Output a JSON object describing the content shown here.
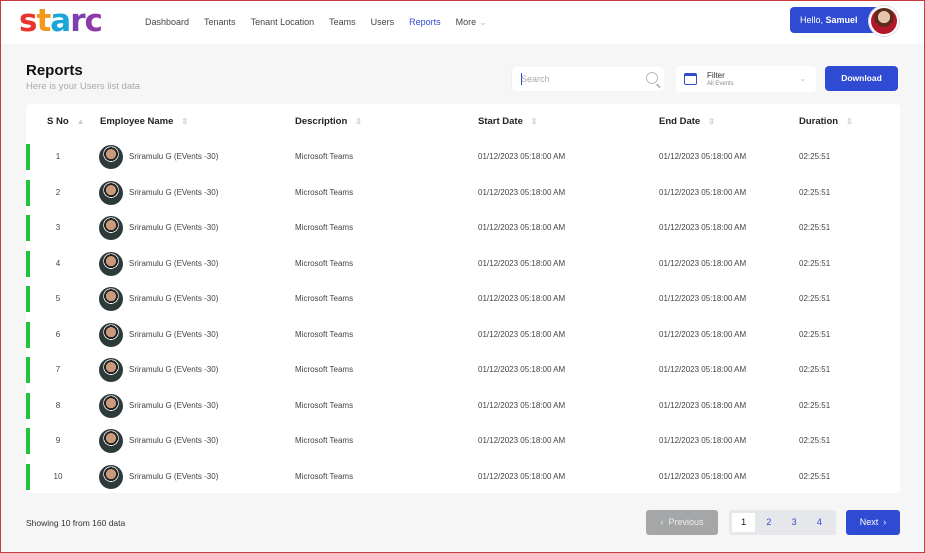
{
  "header": {
    "logo": "starc",
    "nav": [
      "Dashboard",
      "Tenants",
      "Tenant Location",
      "Teams",
      "Users",
      "Reports",
      "More"
    ],
    "active": "Reports",
    "greeting": "Hello,",
    "user": "Samuel"
  },
  "page": {
    "title": "Reports",
    "subtitle": "Here is your Users list data"
  },
  "toolbar": {
    "search_placeholder": "Search",
    "filter_label": "Filter",
    "filter_value": "All Events",
    "download": "Download"
  },
  "table": {
    "columns": [
      "S No",
      "Employee Name",
      "Description",
      "Start Date",
      "End Date",
      "Duration"
    ],
    "rows": [
      {
        "sno": "1",
        "name": "Sriramulu G (EVents -30)",
        "desc": "Microsoft Teams",
        "start": "01/12/2023 05:18:00 AM",
        "end": "01/12/2023 05:18:00 AM",
        "duration": "02:25:51"
      },
      {
        "sno": "2",
        "name": "Sriramulu G (EVents -30)",
        "desc": "Microsoft Teams",
        "start": "01/12/2023 05:18:00 AM",
        "end": "01/12/2023 05:18:00 AM",
        "duration": "02:25:51"
      },
      {
        "sno": "3",
        "name": "Sriramulu G (EVents -30)",
        "desc": "Microsoft Teams",
        "start": "01/12/2023 05:18:00 AM",
        "end": "01/12/2023 05:18:00 AM",
        "duration": "02:25:51"
      },
      {
        "sno": "4",
        "name": "Sriramulu G (EVents -30)",
        "desc": "Microsoft Teams",
        "start": "01/12/2023 05:18:00 AM",
        "end": "01/12/2023 05:18:00 AM",
        "duration": "02:25:51"
      },
      {
        "sno": "5",
        "name": "Sriramulu G (EVents -30)",
        "desc": "Microsoft Teams",
        "start": "01/12/2023 05:18:00 AM",
        "end": "01/12/2023 05:18:00 AM",
        "duration": "02:25:51"
      },
      {
        "sno": "6",
        "name": "Sriramulu G (EVents -30)",
        "desc": "Microsoft Teams",
        "start": "01/12/2023 05:18:00 AM",
        "end": "01/12/2023 05:18:00 AM",
        "duration": "02:25:51"
      },
      {
        "sno": "7",
        "name": "Sriramulu G (EVents -30)",
        "desc": "Microsoft Teams",
        "start": "01/12/2023 05:18:00 AM",
        "end": "01/12/2023 05:18:00 AM",
        "duration": "02:25:51"
      },
      {
        "sno": "8",
        "name": "Sriramulu G (EVents -30)",
        "desc": "Microsoft Teams",
        "start": "01/12/2023 05:18:00 AM",
        "end": "01/12/2023 05:18:00 AM",
        "duration": "02:25:51"
      },
      {
        "sno": "9",
        "name": "Sriramulu G (EVents -30)",
        "desc": "Microsoft Teams",
        "start": "01/12/2023 05:18:00 AM",
        "end": "01/12/2023 05:18:00 AM",
        "duration": "02:25:51"
      },
      {
        "sno": "10",
        "name": "Sriramulu G (EVents -30)",
        "desc": "Microsoft Teams",
        "start": "01/12/2023 05:18:00 AM",
        "end": "01/12/2023 05:18:00 AM",
        "duration": "02:25:51"
      }
    ]
  },
  "footer": {
    "showing": "Showing 10 from 160 data",
    "previous": "Previous",
    "pages": [
      "1",
      "2",
      "3",
      "4"
    ],
    "current_page": "1",
    "next": "Next"
  },
  "colors": {
    "accent": "#2f4bd4",
    "status": "#22c33f"
  }
}
